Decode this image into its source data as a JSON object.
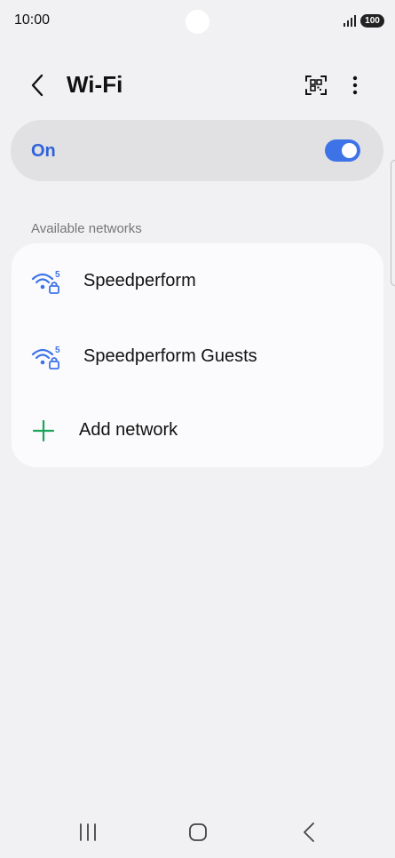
{
  "status_bar": {
    "time": "10:00",
    "battery": "100"
  },
  "header": {
    "title": "Wi-Fi"
  },
  "toggle": {
    "label": "On",
    "state": "on",
    "accent": "#3e73e8"
  },
  "section": {
    "title": "Available networks"
  },
  "networks": [
    {
      "name": "Speedperform",
      "band": "5",
      "secured": true
    },
    {
      "name": "Speedperform Guests",
      "band": "5",
      "secured": true
    }
  ],
  "add_network": {
    "label": "Add network",
    "accent": "#1aa55a"
  },
  "icons": {
    "back": "chevron-left-icon",
    "qr": "qr-scan-icon",
    "more": "more-vertical-icon",
    "wifi": "wifi-lock-icon",
    "plus": "plus-icon"
  }
}
